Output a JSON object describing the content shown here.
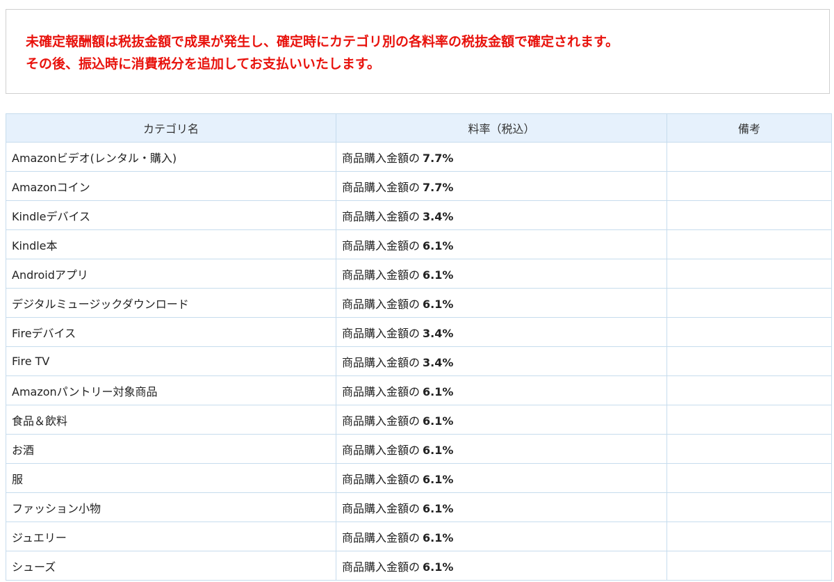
{
  "notice": {
    "line1": "未確定報酬額は税抜金額で成果が発生し、確定時にカテゴリ別の各料率の税抜金額で確定されます。",
    "line2": "その後、振込時に消費税分を追加してお支払いいたします。",
    "color": "#e8120c"
  },
  "table": {
    "headers": [
      "カテゴリ名",
      "料率（税込）",
      "備考"
    ],
    "rate_prefix": "商品購入金額の",
    "rows": [
      {
        "category": "Amazonビデオ(レンタル・購入)",
        "rate": "7.7%",
        "note": ""
      },
      {
        "category": "Amazonコイン",
        "rate": "7.7%",
        "note": ""
      },
      {
        "category": "Kindleデバイス",
        "rate": "3.4%",
        "note": ""
      },
      {
        "category": "Kindle本",
        "rate": "6.1%",
        "note": ""
      },
      {
        "category": "Androidアプリ",
        "rate": "6.1%",
        "note": ""
      },
      {
        "category": "デジタルミュージックダウンロード",
        "rate": "6.1%",
        "note": ""
      },
      {
        "category": "Fireデバイス",
        "rate": "3.4%",
        "note": ""
      },
      {
        "category": "Fire TV",
        "rate": "3.4%",
        "note": ""
      },
      {
        "category": "Amazonパントリー対象商品",
        "rate": "6.1%",
        "note": ""
      },
      {
        "category": "食品＆飲料",
        "rate": "6.1%",
        "note": ""
      },
      {
        "category": "お酒",
        "rate": "6.1%",
        "note": ""
      },
      {
        "category": "服",
        "rate": "6.1%",
        "note": ""
      },
      {
        "category": "ファッション小物",
        "rate": "6.1%",
        "note": ""
      },
      {
        "category": "ジュエリー",
        "rate": "6.1%",
        "note": ""
      },
      {
        "category": "シューズ",
        "rate": "6.1%",
        "note": ""
      }
    ],
    "header_bg": "#e6f1fc",
    "border_color": "#c6dced"
  }
}
